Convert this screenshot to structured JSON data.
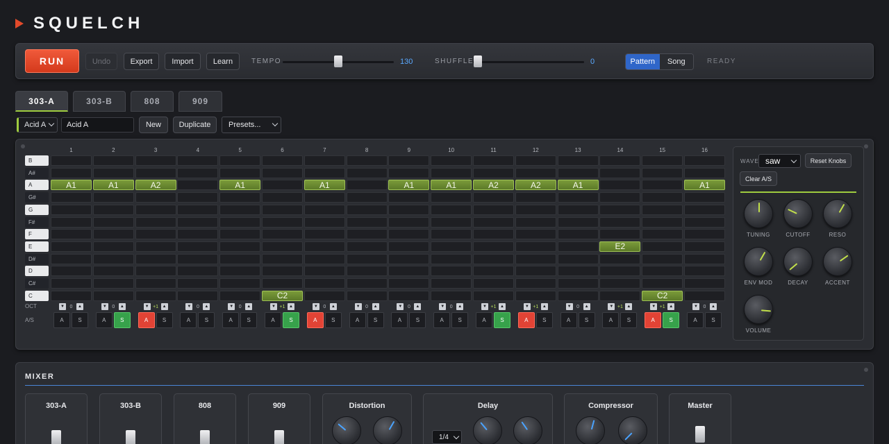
{
  "app": {
    "title": "SQUELCH"
  },
  "transport": {
    "run_label": "RUN",
    "undo_label": "Undo",
    "export_label": "Export",
    "import_label": "Import",
    "learn_label": "Learn",
    "tempo_label": "TEMPO",
    "tempo_value": "130",
    "shuffle_label": "SHUFFLE",
    "shuffle_value": "0",
    "mode_pattern": "Pattern",
    "mode_song": "Song",
    "status": "READY"
  },
  "tabs": [
    "303-A",
    "303-B",
    "808",
    "909"
  ],
  "pattern_bar": {
    "selected_pattern": "Acid A",
    "name_value": "Acid A",
    "new_label": "New",
    "duplicate_label": "Duplicate",
    "presets_label": "Presets..."
  },
  "sequencer": {
    "steps": [
      "1",
      "2",
      "3",
      "4",
      "5",
      "6",
      "7",
      "8",
      "9",
      "10",
      "11",
      "12",
      "13",
      "14",
      "15",
      "16"
    ],
    "rows": [
      "B",
      "A#",
      "A",
      "G#",
      "G",
      "F#",
      "F",
      "E",
      "D#",
      "D",
      "C#",
      "C"
    ],
    "notes": [
      {
        "step": 1,
        "row": "A",
        "label": "A1"
      },
      {
        "step": 2,
        "row": "A",
        "label": "A1"
      },
      {
        "step": 3,
        "row": "A",
        "label": "A2"
      },
      {
        "step": 5,
        "row": "A",
        "label": "A1"
      },
      {
        "step": 7,
        "row": "A",
        "label": "A1"
      },
      {
        "step": 9,
        "row": "A",
        "label": "A1"
      },
      {
        "step": 10,
        "row": "A",
        "label": "A1"
      },
      {
        "step": 11,
        "row": "A",
        "label": "A2"
      },
      {
        "step": 12,
        "row": "A",
        "label": "A2"
      },
      {
        "step": 13,
        "row": "A",
        "label": "A1"
      },
      {
        "step": 16,
        "row": "A",
        "label": "A1"
      },
      {
        "step": 14,
        "row": "E",
        "label": "E2"
      },
      {
        "step": 6,
        "row": "C",
        "label": "C2"
      },
      {
        "step": 15,
        "row": "C",
        "label": "C2"
      }
    ],
    "oct_label": "OCT",
    "as_label": "A/S",
    "octaves": [
      "0",
      "0",
      "+1",
      "0",
      "0",
      "+1",
      "0",
      "0",
      "0",
      "0",
      "+1",
      "+1",
      "0",
      "+1",
      "+1",
      "0"
    ],
    "accents": [
      false,
      false,
      true,
      false,
      false,
      false,
      true,
      false,
      false,
      false,
      false,
      true,
      false,
      false,
      true,
      false
    ],
    "slides": [
      false,
      true,
      false,
      false,
      false,
      true,
      false,
      false,
      false,
      false,
      true,
      false,
      false,
      false,
      true,
      false
    ],
    "accent_btn": "A",
    "slide_btn": "S",
    "oct_down": "▼",
    "oct_up": "▲"
  },
  "synth": {
    "wave_label": "WAVE",
    "wave_value": "saw",
    "reset_label": "Reset Knobs",
    "clear_label": "Clear A/S",
    "knobs": [
      {
        "label": "TUNING",
        "rotation_deg": 0
      },
      {
        "label": "CUTOFF",
        "rotation_deg": -65
      },
      {
        "label": "RESO",
        "rotation_deg": 30
      },
      {
        "label": "ENV MOD",
        "rotation_deg": 30
      },
      {
        "label": "DECAY",
        "rotation_deg": -130
      },
      {
        "label": "ACCENT",
        "rotation_deg": 55
      },
      {
        "label": "VOLUME",
        "rotation_deg": 95
      }
    ]
  },
  "mixer": {
    "title": "MIXER",
    "channels": [
      "303-A",
      "303-B",
      "808",
      "909"
    ],
    "fx": [
      {
        "title": "Distortion",
        "knob_rotations_deg": [
          -50,
          30
        ]
      },
      {
        "title": "Delay",
        "division": "1/4",
        "knob_rotations_deg": [
          -40,
          -35
        ]
      },
      {
        "title": "Compressor",
        "knob_rotations_deg": [
          15,
          -135
        ]
      }
    ],
    "master": "Master"
  },
  "colors": {
    "accent_green": "#9fcc3f",
    "run_red": "#e24a2b",
    "value_blue": "#5aa9ff",
    "mode_active": "#2f66c9"
  }
}
